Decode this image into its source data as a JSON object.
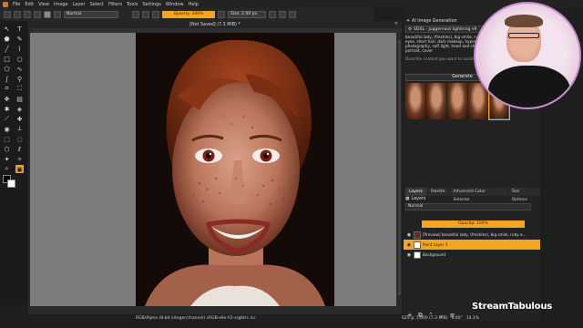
{
  "menu": [
    "File",
    "Edit",
    "View",
    "Image",
    "Layer",
    "Select",
    "Filters",
    "Tools",
    "Settings",
    "Window",
    "Help"
  ],
  "tool_options": {
    "blend": "Normal",
    "opacity": "Opacity: 100%",
    "size": "Size: 2.00 px"
  },
  "document": {
    "title": "[Not Saved] (7.3 MiB) *",
    "status": "RGB/Alpha (8-bit integer/channel)  sRGB-elle-V2-srgbtrc.icc",
    "zoom_info": "625 g: 1,000 (7.3 MiB)",
    "angle": "0.00°",
    "zoom": "14.1%"
  },
  "ai_panel": {
    "title": "AI Image Generation",
    "model": "SDXL - Juggernaut lightning v9",
    "prompt": "beautiful lady, (freckles), big smile, ruby eyes, short hair, dark makeup, hyperdetailed photography, soft light, head and shoulders portrait, cover",
    "negative": "Describe content you want to avoid.",
    "generate": "Generate"
  },
  "layers_panel": {
    "tabs": [
      "Layers",
      "Palette",
      "Advanced Color Selector",
      "Tool Options"
    ],
    "title": "Layers",
    "blend": "Normal",
    "opacity": "Opacity: 100%",
    "items": [
      {
        "name": "[Preview] beautiful lady, (freckles), big smile, ruby e..."
      },
      {
        "name": "Paint Layer 1"
      },
      {
        "name": "Background"
      }
    ]
  },
  "watermark": "StreamTabulous",
  "colors": {
    "accent": "#f5a524"
  }
}
